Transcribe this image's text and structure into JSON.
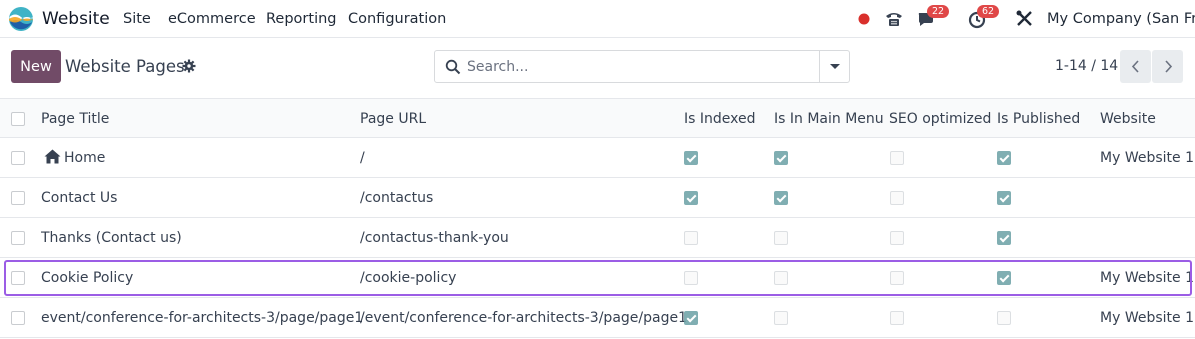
{
  "navbar": {
    "app_name": "Website",
    "menus": [
      "Site",
      "eCommerce",
      "Reporting",
      "Configuration"
    ],
    "messages_count": "22",
    "activities_count": "62",
    "company": "My Company (San Franc"
  },
  "control_panel": {
    "new_label": "New",
    "title": "Website Pages",
    "search_placeholder": "Search...",
    "pager": "1-14 / 14"
  },
  "table": {
    "columns": [
      "Page Title",
      "Page URL",
      "Is Indexed",
      "Is In Main Menu",
      "SEO optimized",
      "Is Published",
      "Website"
    ],
    "rows": [
      {
        "title": "Home",
        "url": "/",
        "indexed": true,
        "main_menu": true,
        "seo": false,
        "published": true,
        "website": "My Website 1",
        "home": true
      },
      {
        "title": "Contact Us",
        "url": "/contactus",
        "indexed": true,
        "main_menu": true,
        "seo": false,
        "published": true,
        "website": ""
      },
      {
        "title": "Thanks (Contact us)",
        "url": "/contactus-thank-you",
        "indexed": false,
        "main_menu": false,
        "seo": false,
        "published": true,
        "website": ""
      },
      {
        "title": "Cookie Policy",
        "url": "/cookie-policy",
        "indexed": false,
        "main_menu": false,
        "seo": false,
        "published": true,
        "website": "My Website 1"
      },
      {
        "title": "event/conference-for-architects-3/page/page1",
        "url": "/event/conference-for-architects-3/page/page1",
        "indexed": true,
        "main_menu": false,
        "seo": false,
        "published": false,
        "website": "My Website 1"
      }
    ]
  },
  "colors": {
    "accent": "#714b67",
    "check": "#6aa1a5",
    "highlight": "#9b5de5"
  }
}
